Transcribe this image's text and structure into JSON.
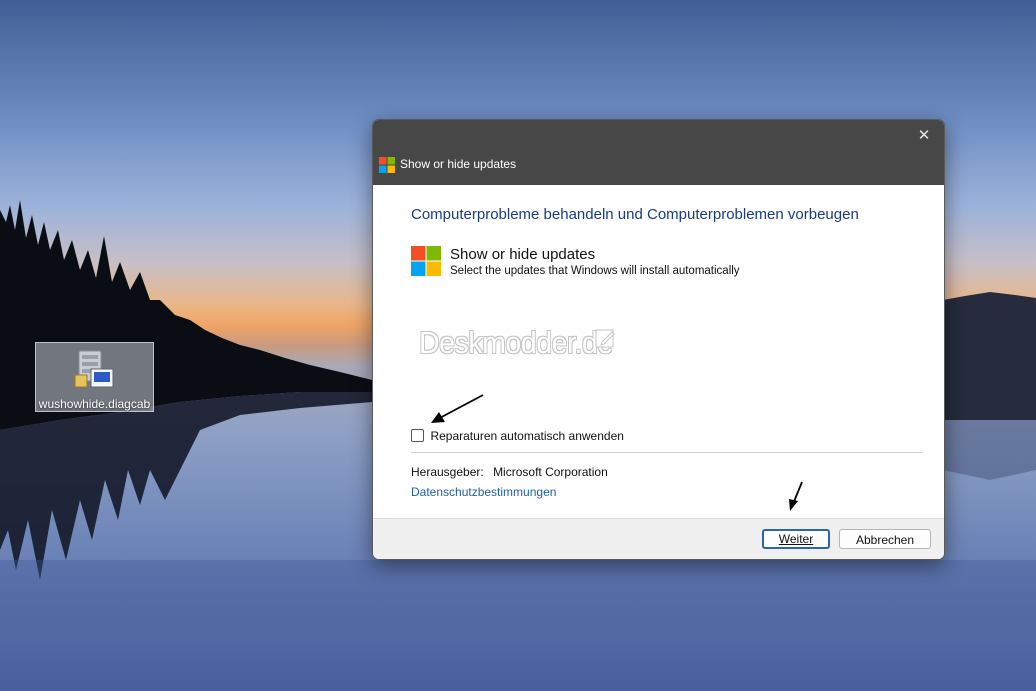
{
  "desktop": {
    "icon": {
      "label": "wushowhide.diagcab",
      "icon": "troubleshooter-package-icon"
    }
  },
  "dialog": {
    "title": "Show or hide updates",
    "close_symbol": "✕",
    "heading": "Computerprobleme behandeln und Computerproblemen vorbeugen",
    "tool": {
      "name": "Show or hide updates",
      "description": "Select the updates that Windows will install automatically"
    },
    "watermark": "Deskmodder.de",
    "auto_repair": {
      "label": "Reparaturen automatisch anwenden",
      "checked": false
    },
    "publisher": {
      "label": "Herausgeber:",
      "value": "Microsoft Corporation"
    },
    "privacy_link": "Datenschutzbestimmungen",
    "buttons": {
      "next": "Weiter",
      "cancel": "Abbrechen"
    }
  },
  "colors": {
    "heading": "#1b3a82",
    "link": "#1f5fa8",
    "titlebar": "#474747",
    "ms_red": "#f25022",
    "ms_green": "#7fba00",
    "ms_blue": "#00a4ef",
    "ms_yellow": "#ffb900"
  }
}
